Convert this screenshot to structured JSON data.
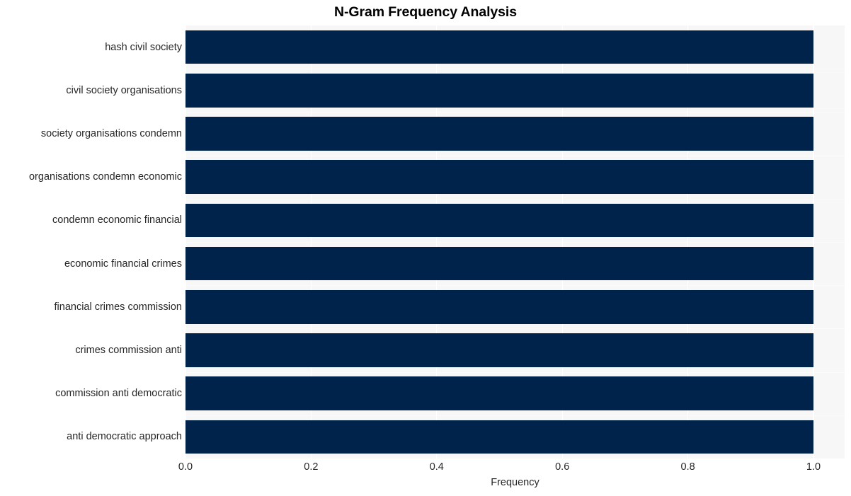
{
  "chart_data": {
    "type": "bar",
    "orientation": "horizontal",
    "title": "N-Gram Frequency Analysis",
    "xlabel": "Frequency",
    "ylabel": "",
    "categories": [
      "hash civil society",
      "civil society organisations",
      "society organisations condemn",
      "organisations condemn economic",
      "condemn economic financial",
      "economic financial crimes",
      "financial crimes commission",
      "crimes commission anti",
      "commission anti democratic",
      "anti democratic approach"
    ],
    "values": [
      1.0,
      1.0,
      1.0,
      1.0,
      1.0,
      1.0,
      1.0,
      1.0,
      1.0,
      1.0
    ],
    "xlim": [
      0.0,
      1.0
    ],
    "xticks": [
      0.0,
      0.2,
      0.4,
      0.6,
      0.8,
      1.0
    ],
    "xticklabels": [
      "0.0",
      "0.2",
      "0.4",
      "0.6",
      "0.8",
      "1.0"
    ],
    "grid": true,
    "legend": false,
    "bar_color": "#00234c",
    "plot_background": "#f7f7f7",
    "figure_background": "#ffffff",
    "gridline_color": "#ffffff",
    "text_color": "#262626",
    "title_color": "#000000"
  }
}
